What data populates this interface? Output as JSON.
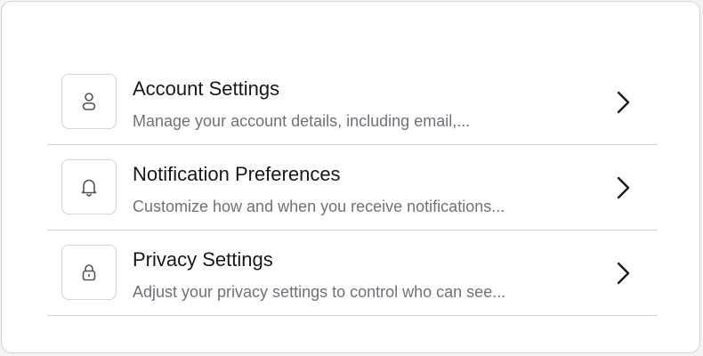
{
  "settings": {
    "items": [
      {
        "title": "Account Settings",
        "description": "Manage your account details, including email,...",
        "icon": "user-icon"
      },
      {
        "title": "Notification Preferences",
        "description": "Customize how and when you receive notifications...",
        "icon": "bell-icon"
      },
      {
        "title": "Privacy Settings",
        "description": "Adjust your privacy settings to control who can see...",
        "icon": "lock-icon"
      }
    ]
  }
}
